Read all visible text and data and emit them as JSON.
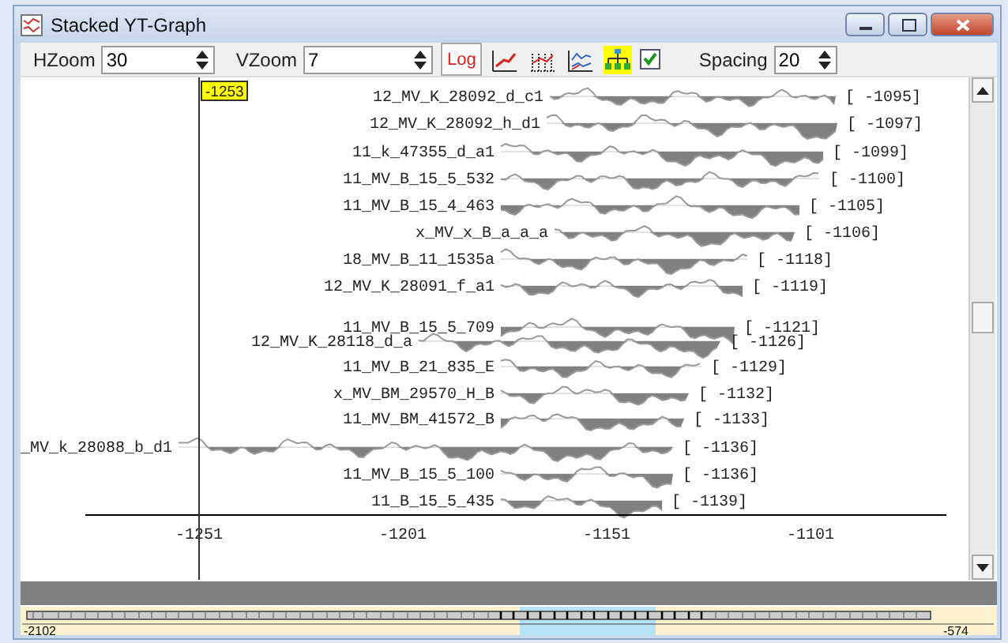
{
  "window": {
    "title": "Stacked YT-Graph"
  },
  "toolbar": {
    "hzoom": {
      "label": "HZoom",
      "value": "30"
    },
    "vzoom": {
      "label": "VZoom",
      "value": "7"
    },
    "log_button": {
      "label": "Log",
      "selected": true
    },
    "checkbox": {
      "checked": true
    },
    "spacing": {
      "label": "Spacing",
      "value": "20"
    }
  },
  "graph": {
    "cursor_label": "-1253",
    "traces": [
      {
        "label": "12_MV_K_28092_d_c1",
        "reading": "[ -1095]"
      },
      {
        "label": "12_MV_K_28092_h_d1",
        "reading": "[ -1097]"
      },
      {
        "label": "11_k_47355_d_a1",
        "reading": "[ -1099]"
      },
      {
        "label": "11_MV_B_15_5_532",
        "reading": "[ -1100]"
      },
      {
        "label": "11_MV_B_15_4_463",
        "reading": "[ -1105]"
      },
      {
        "label": "x_MV_x_B_a_a_a",
        "reading": "[ -1106]"
      },
      {
        "label": "18_MV_B_11_1535a",
        "reading": "[ -1118]"
      },
      {
        "label": "12_MV_K_28091_f_a1",
        "reading": "[ -1119]"
      },
      {
        "label": "11_MV_B_15_5_709",
        "reading": "[ -1121]"
      },
      {
        "label": "12_MV_K_28118_d_a",
        "reading": "[ -1126]"
      },
      {
        "label": "11_MV_B_21_835_E",
        "reading": "[ -1129]"
      },
      {
        "label": "x_MV_BM_29570_H_B",
        "reading": "[ -1132]"
      },
      {
        "label": "11_MV_BM_41572_B",
        "reading": "[ -1133]"
      },
      {
        "label": "_MV_k_28088_b_d1",
        "reading": "[ -1136]"
      },
      {
        "label": "11_MV_B_15_5_100",
        "reading": "[ -1136]"
      },
      {
        "label": "11_B_15_5_435",
        "reading": "[ -1139]"
      }
    ],
    "axis_ticks": [
      "-1251",
      "-1201",
      "-1151",
      "-1101"
    ]
  },
  "overview": {
    "start_label": "-2102",
    "end_label": "-574"
  }
}
